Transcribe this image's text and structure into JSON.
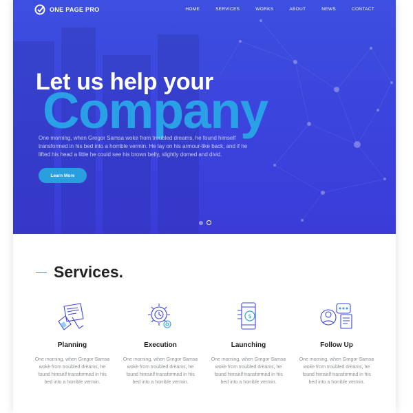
{
  "brand": {
    "name": "ONE PAGE PRO"
  },
  "nav": {
    "items": [
      "HOME",
      "SERVICES",
      "WORKS",
      "ABOUT",
      "NEWS",
      "CONTACT"
    ]
  },
  "hero": {
    "headline": "Let us help your",
    "big_word": "Company",
    "description": "One morning, when Gregor Samsa woke from troubled dreams, he found himself transformed in his bed into a horrible vermin. He lay on his armour-like back, and if he lifted his head a little he could see his brown belly, slightly domed and divid.",
    "cta_label": "Learn More",
    "slide_count": 2,
    "active_slide": 2
  },
  "services": {
    "title": "Services.",
    "items": [
      {
        "title": "Planning",
        "icon": "planning-icon",
        "desc": "One morning, when Gregor Samsa woke from troubled dreams, he found himself transformed in his bed into a horrible vermin."
      },
      {
        "title": "Execution",
        "icon": "execution-gear-icon",
        "desc": "One morning, when Gregor Samsa woke from troubled dreams, he found himself transformed in his bed into a horrible vermin."
      },
      {
        "title": "Launching",
        "icon": "launching-phone-icon",
        "desc": "One morning, when Gregor Samsa woke from troubled dreams, he found himself transformed in his bed into a horrible vermin."
      },
      {
        "title": "Follow Up",
        "icon": "follow-up-icon",
        "desc": "One morning, when Gregor Samsa woke from troubled dreams, he found himself transformed in his bed into a horrible vermin."
      }
    ]
  },
  "colors": {
    "hero_blue": "#3b45dd",
    "accent": "#2a9fe0",
    "heading": "#222222",
    "muted": "#8a8f96"
  }
}
